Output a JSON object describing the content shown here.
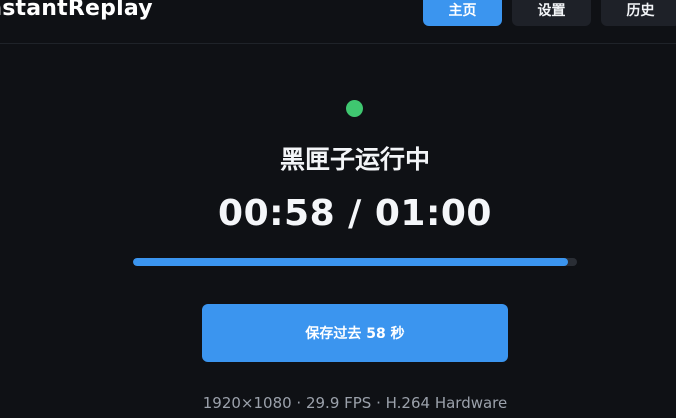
{
  "header": {
    "app_title": "InstantReplay",
    "tabs": [
      {
        "label": "主页",
        "active": true
      },
      {
        "label": "设置",
        "active": false
      },
      {
        "label": "历史",
        "active": false
      }
    ]
  },
  "main": {
    "status_color": "#3fc770",
    "status_text": "黑匣子运行中",
    "timer": {
      "elapsed": "00:58",
      "total": "01:00",
      "display": "00:58 / 01:00"
    },
    "progress_fraction": 0.98,
    "save_button_label": "保存过去 58 秒",
    "info_line": "1920×1080 · 29.9 FPS · H.264 Hardware"
  },
  "colors": {
    "accent": "#3b95ef",
    "background": "#0f1115",
    "status_ok": "#3fc770"
  }
}
